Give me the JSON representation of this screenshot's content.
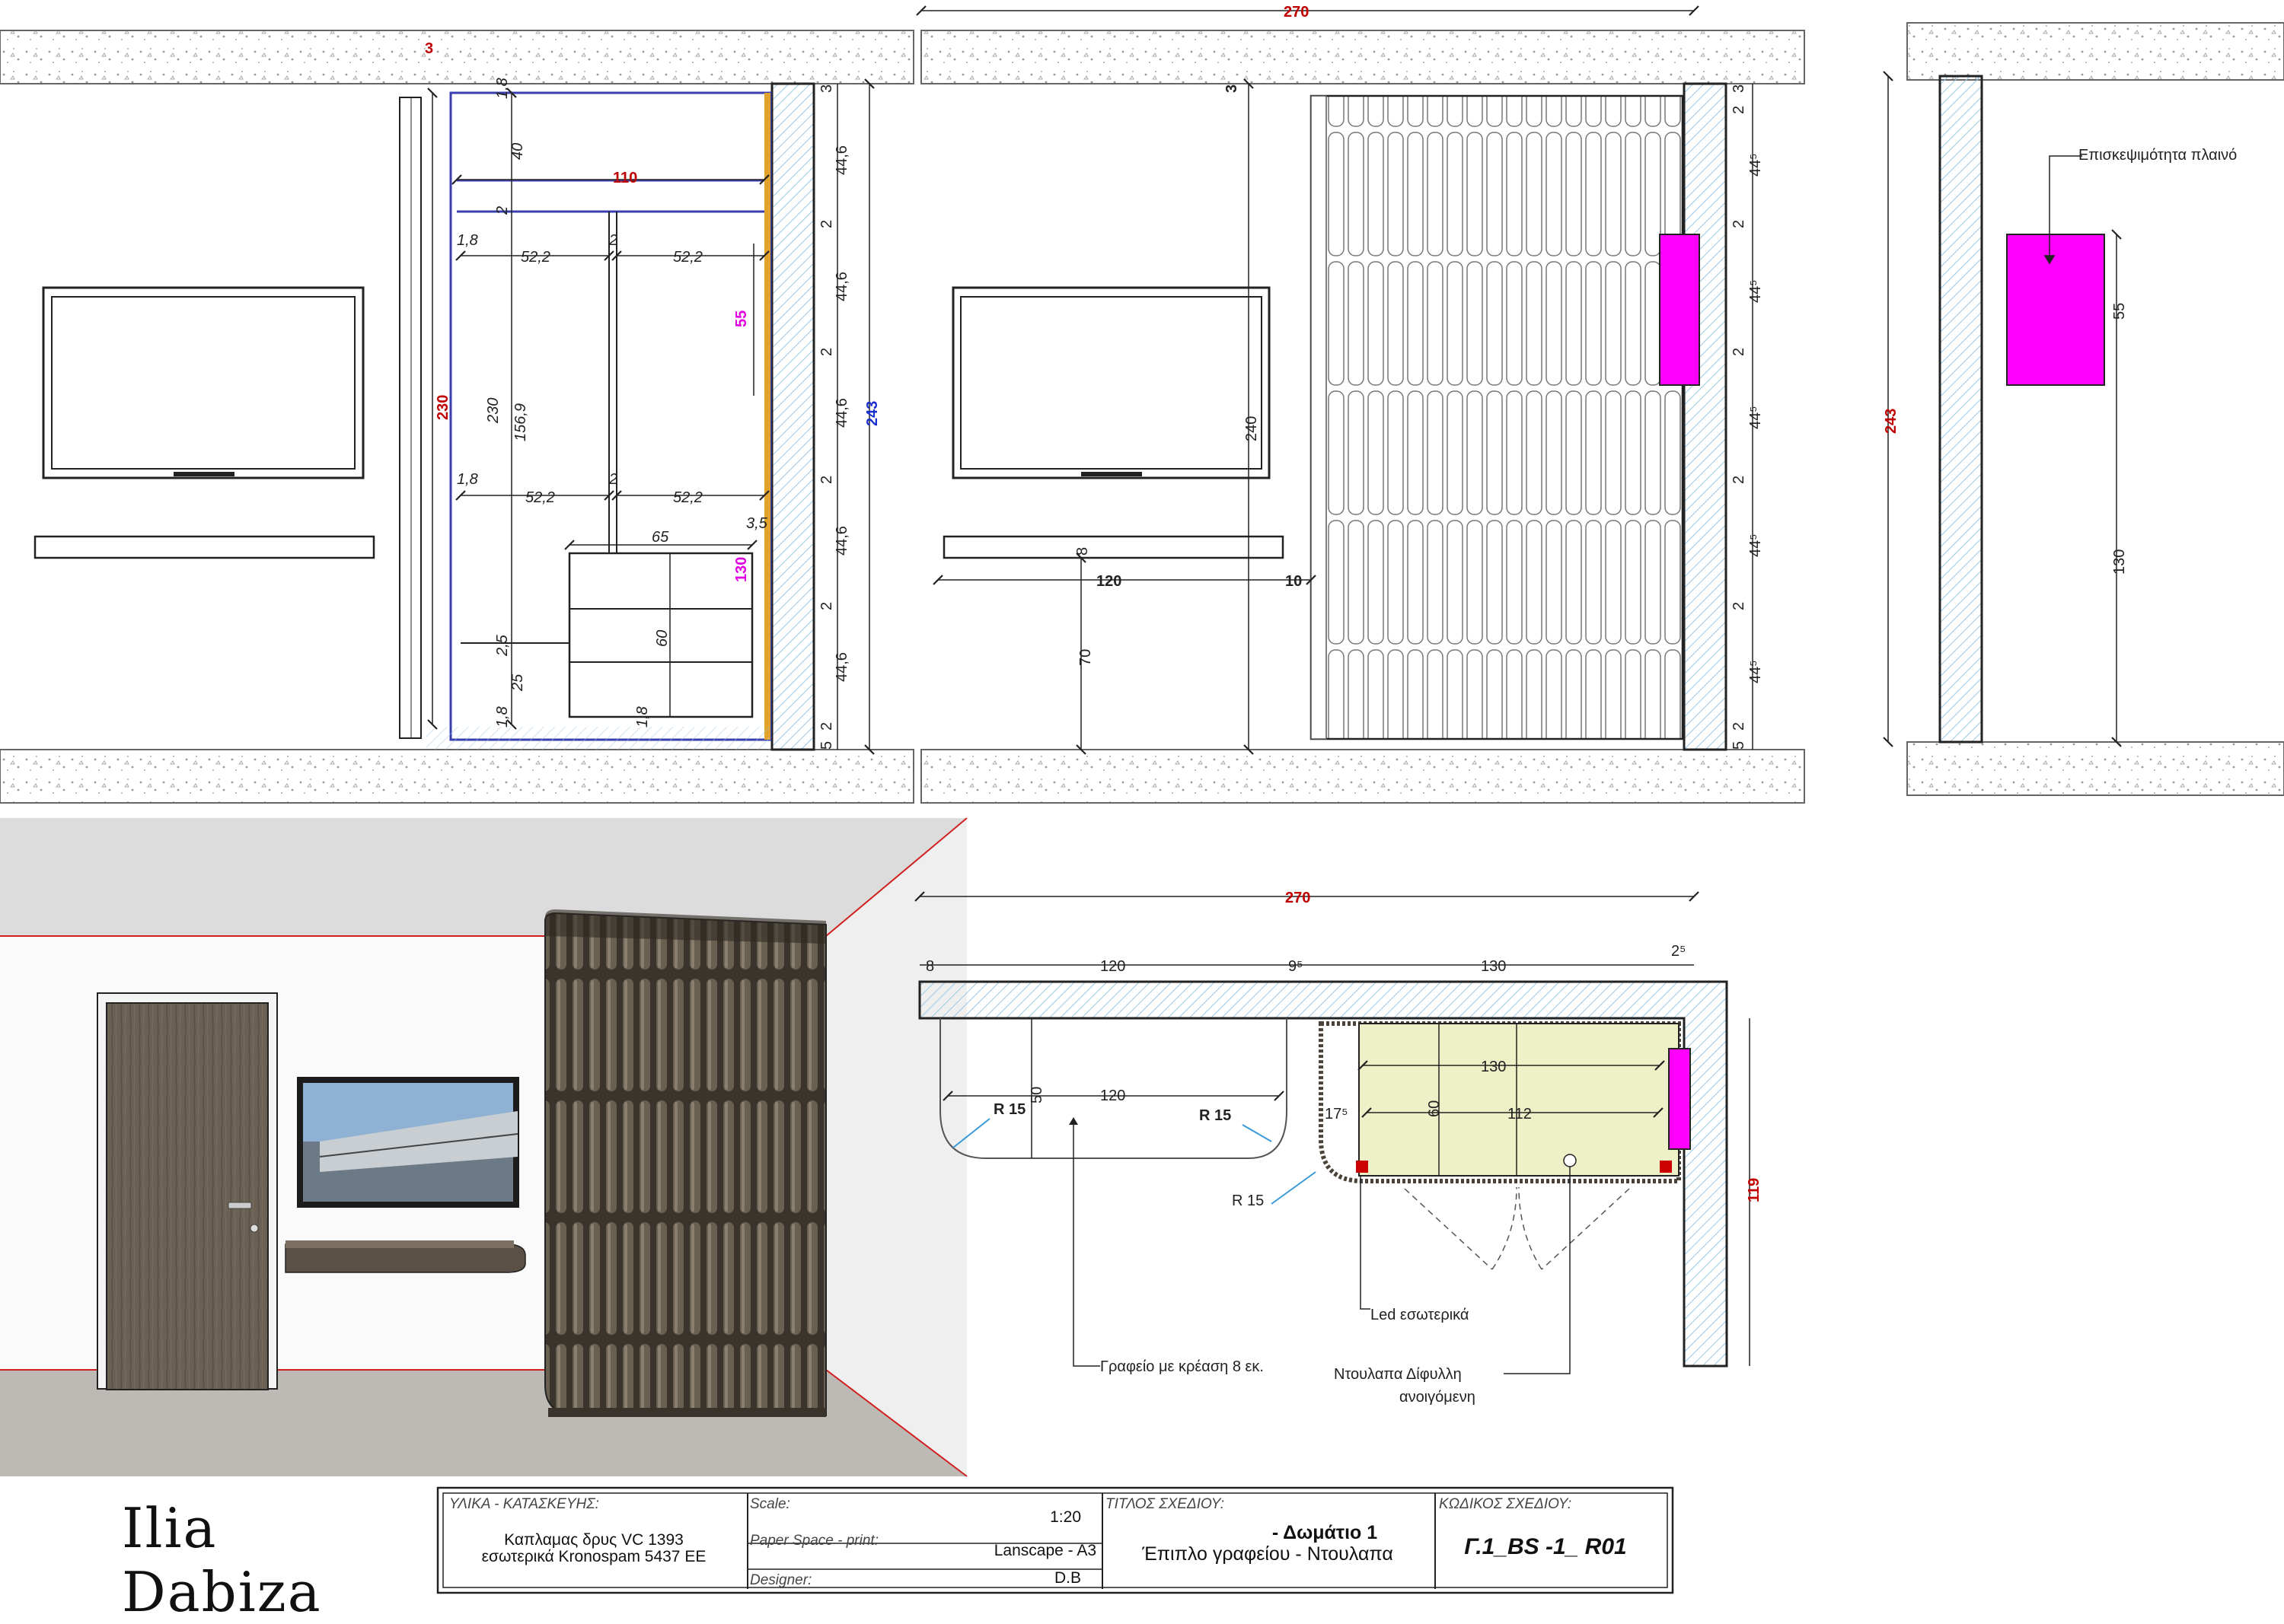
{
  "elevation_a": {
    "dims_red": [
      "3",
      "110",
      "230"
    ],
    "dims_blue": [
      "243"
    ],
    "dims_magenta": [
      "55",
      "130"
    ],
    "dims": [
      "1,8",
      "40",
      "2",
      "1,8",
      "52,2",
      "2",
      "52,2",
      "230",
      "156,9",
      "1,8",
      "52,2",
      "2",
      "52,2",
      "3,5",
      "65",
      "60",
      "2,5",
      "25",
      "1,8",
      "1,8"
    ],
    "right_chain": [
      "3",
      "44,6",
      "2",
      "44,6",
      "2",
      "44,6",
      "2",
      "44,6",
      "2",
      "44,6",
      "2",
      "5"
    ]
  },
  "elevation_b": {
    "top_dim": "270",
    "dims": [
      "3",
      "240",
      "8",
      "120",
      "10",
      "70"
    ],
    "right_chain": [
      "3",
      "2",
      "44⁵",
      "2",
      "44⁵",
      "2",
      "44⁵",
      "2",
      "44⁵",
      "2",
      "44⁵",
      "2",
      "5"
    ]
  },
  "elevation_c": {
    "height_dim": "243",
    "note": "Επισκεψιμότητα πλαινό",
    "dims": [
      "55",
      "130"
    ]
  },
  "plan": {
    "top_dim": "270",
    "chain": [
      "8",
      "120",
      "9⁵",
      "130",
      "2⁵"
    ],
    "desk_width": "120",
    "desk_depth": "50",
    "radius_left": "R 15",
    "radius_right": "R 15",
    "radius_corner": "R 15",
    "wardrobe_width": "130",
    "wardrobe_inner": "112",
    "wardrobe_depth": "60",
    "offset": "17⁵",
    "side_dim": "119",
    "label_led": "Led εσωτερικά",
    "label_desk": "Γραφείο με κρέαση 8 εκ.",
    "label_wardrobe": [
      "Ντουλαπα Δίφυλλη",
      "ανοιγόμενη"
    ]
  },
  "title_block": {
    "materials_label": "ΥΛΙΚΑ - ΚΑΤΑΣΚΕΥΗΣ:",
    "materials": [
      "Καπλαμας δρυς VC 1393",
      "εσωτερικά Kronospam 5437 EE"
    ],
    "scale_label": "Scale:",
    "scale": "1:20",
    "paper_label": "Paper Space - print:",
    "paper": "Lanscape - A3",
    "designer_label": "Designer:",
    "designer": "D.B",
    "title_label": "ΤΙΤΛΟΣ ΣΧΕΔΙΟΥ:",
    "title": [
      "- Δωμάτιο 1",
      "Έπιπλο γραφείου - Ντουλαπα"
    ],
    "code_label": "ΚΩΔΙΚΟΣ ΣΧΕΔΙΟΥ:",
    "code": "Γ.1_BS -1_ R01"
  },
  "signature": "Ilia Dabiza",
  "colors": {
    "dim_red": "#c00000",
    "dim_blue": "#1a2fd0",
    "dim_magenta": "#e000e0",
    "access_panel": "#ff00ff",
    "wardrobe_fill": "#eef0c8",
    "wall_hatch": "#a9d0e8",
    "wood_dark": "#4a4238"
  }
}
